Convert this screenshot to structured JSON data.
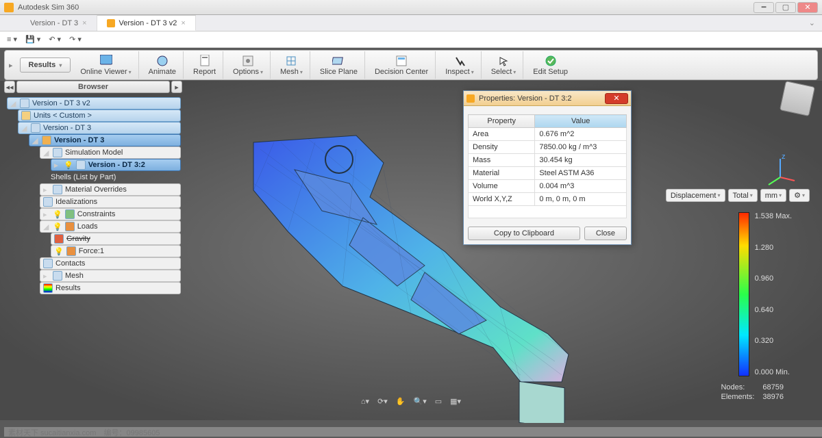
{
  "app": {
    "title": "Autodesk Sim 360"
  },
  "tabs": [
    {
      "label": "Version - DT 3"
    },
    {
      "label": "Version - DT 3 v2",
      "active": true
    }
  ],
  "ribbon": {
    "results": "Results",
    "buttons": [
      {
        "label": "Online Viewer",
        "dd": true
      },
      {
        "label": "Animate"
      },
      {
        "label": "Report"
      },
      {
        "label": "Options",
        "dd": true
      },
      {
        "label": "Mesh",
        "dd": true
      },
      {
        "label": "Slice Plane"
      },
      {
        "label": "Decision Center"
      },
      {
        "label": "Inspect",
        "dd": true
      },
      {
        "label": "Select",
        "dd": true
      },
      {
        "label": "Edit Setup"
      }
    ]
  },
  "browser": {
    "title": "Browser",
    "root": "Version - DT 3 v2",
    "units": "Units < Custom >",
    "part": "Version - DT 3",
    "sel_part": "Version - DT 3",
    "sim_model": "Simulation Model",
    "sel_instance": "Version - DT 3:2",
    "shells": "Shells (List by Part)",
    "overrides": "Material Overrides",
    "idealizations": "Idealizations",
    "constraints": "Constraints",
    "loads": "Loads",
    "gravity": "Gravity",
    "force": "Force:1",
    "contacts": "Contacts",
    "mesh": "Mesh",
    "results_node": "Results"
  },
  "properties": {
    "title": "Properties: Version - DT 3:2",
    "cols": {
      "prop": "Property",
      "val": "Value"
    },
    "rows": [
      {
        "p": "Area",
        "v": "0.676 m^2"
      },
      {
        "p": "Density",
        "v": "7850.00 kg / m^3"
      },
      {
        "p": "Mass",
        "v": "30.454 kg"
      },
      {
        "p": "Material",
        "v": "Steel ASTM A36"
      },
      {
        "p": "Volume",
        "v": "0.004 m^3"
      },
      {
        "p": "World X,Y,Z",
        "v": "0 m, 0 m, 0 m"
      }
    ],
    "copy": "Copy to Clipboard",
    "close": "Close"
  },
  "legend": {
    "dd1": "Displacement",
    "dd2": "Total",
    "dd3": "mm",
    "ticks": [
      "1.538 Max.",
      "1.280",
      "0.960",
      "0.640",
      "0.320",
      "0.000 Min."
    ]
  },
  "stats": {
    "nodes_l": "Nodes:",
    "nodes_v": "68759",
    "elems_l": "Elements:",
    "elems_v": "38976"
  },
  "watermark": {
    "site": "素材天下 sucaitianxia.com",
    "code_l": "编号：",
    "code": "09985605"
  }
}
